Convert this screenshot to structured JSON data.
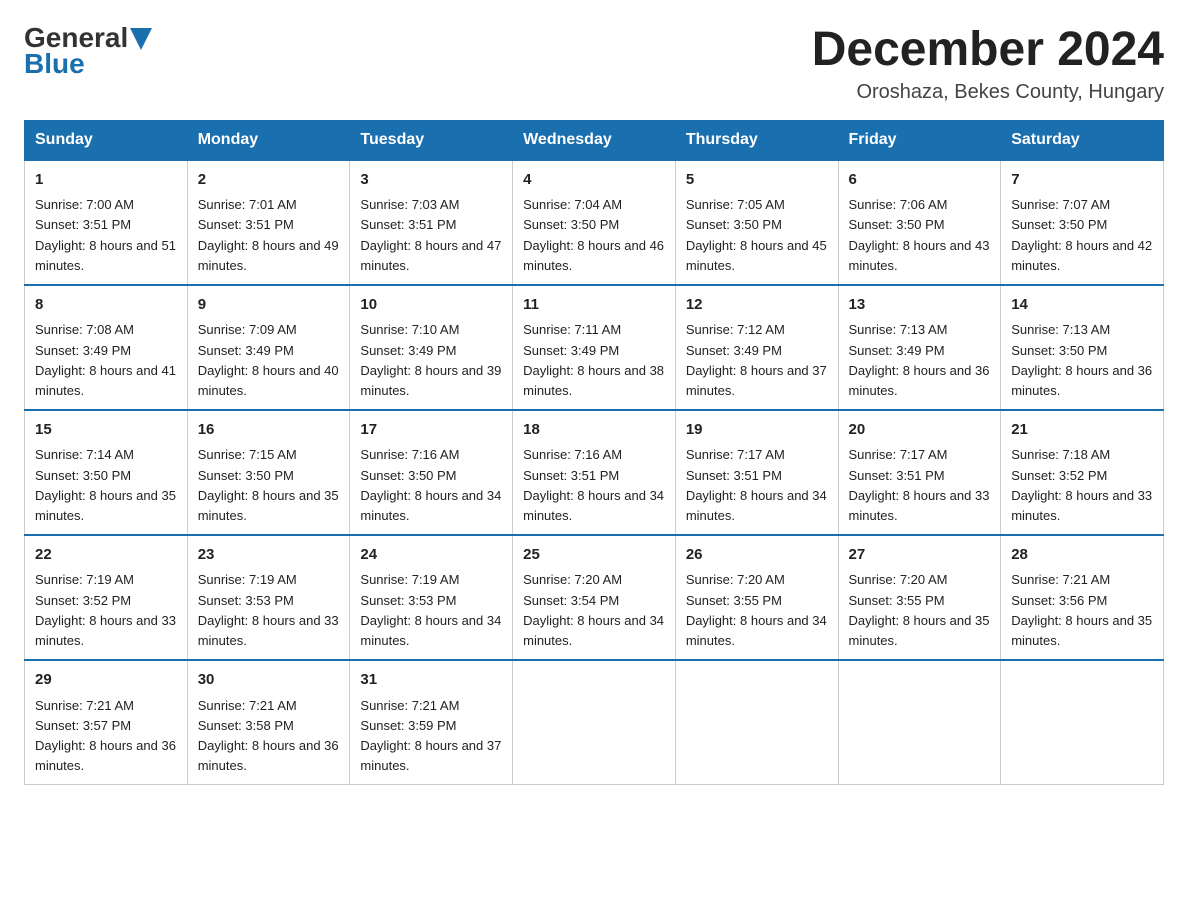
{
  "logo": {
    "general": "General",
    "blue": "Blue"
  },
  "title": "December 2024",
  "subtitle": "Oroshaza, Bekes County, Hungary",
  "days_of_week": [
    "Sunday",
    "Monday",
    "Tuesday",
    "Wednesday",
    "Thursday",
    "Friday",
    "Saturday"
  ],
  "weeks": [
    [
      {
        "day": "1",
        "sunrise": "Sunrise: 7:00 AM",
        "sunset": "Sunset: 3:51 PM",
        "daylight": "Daylight: 8 hours and 51 minutes."
      },
      {
        "day": "2",
        "sunrise": "Sunrise: 7:01 AM",
        "sunset": "Sunset: 3:51 PM",
        "daylight": "Daylight: 8 hours and 49 minutes."
      },
      {
        "day": "3",
        "sunrise": "Sunrise: 7:03 AM",
        "sunset": "Sunset: 3:51 PM",
        "daylight": "Daylight: 8 hours and 47 minutes."
      },
      {
        "day": "4",
        "sunrise": "Sunrise: 7:04 AM",
        "sunset": "Sunset: 3:50 PM",
        "daylight": "Daylight: 8 hours and 46 minutes."
      },
      {
        "day": "5",
        "sunrise": "Sunrise: 7:05 AM",
        "sunset": "Sunset: 3:50 PM",
        "daylight": "Daylight: 8 hours and 45 minutes."
      },
      {
        "day": "6",
        "sunrise": "Sunrise: 7:06 AM",
        "sunset": "Sunset: 3:50 PM",
        "daylight": "Daylight: 8 hours and 43 minutes."
      },
      {
        "day": "7",
        "sunrise": "Sunrise: 7:07 AM",
        "sunset": "Sunset: 3:50 PM",
        "daylight": "Daylight: 8 hours and 42 minutes."
      }
    ],
    [
      {
        "day": "8",
        "sunrise": "Sunrise: 7:08 AM",
        "sunset": "Sunset: 3:49 PM",
        "daylight": "Daylight: 8 hours and 41 minutes."
      },
      {
        "day": "9",
        "sunrise": "Sunrise: 7:09 AM",
        "sunset": "Sunset: 3:49 PM",
        "daylight": "Daylight: 8 hours and 40 minutes."
      },
      {
        "day": "10",
        "sunrise": "Sunrise: 7:10 AM",
        "sunset": "Sunset: 3:49 PM",
        "daylight": "Daylight: 8 hours and 39 minutes."
      },
      {
        "day": "11",
        "sunrise": "Sunrise: 7:11 AM",
        "sunset": "Sunset: 3:49 PM",
        "daylight": "Daylight: 8 hours and 38 minutes."
      },
      {
        "day": "12",
        "sunrise": "Sunrise: 7:12 AM",
        "sunset": "Sunset: 3:49 PM",
        "daylight": "Daylight: 8 hours and 37 minutes."
      },
      {
        "day": "13",
        "sunrise": "Sunrise: 7:13 AM",
        "sunset": "Sunset: 3:49 PM",
        "daylight": "Daylight: 8 hours and 36 minutes."
      },
      {
        "day": "14",
        "sunrise": "Sunrise: 7:13 AM",
        "sunset": "Sunset: 3:50 PM",
        "daylight": "Daylight: 8 hours and 36 minutes."
      }
    ],
    [
      {
        "day": "15",
        "sunrise": "Sunrise: 7:14 AM",
        "sunset": "Sunset: 3:50 PM",
        "daylight": "Daylight: 8 hours and 35 minutes."
      },
      {
        "day": "16",
        "sunrise": "Sunrise: 7:15 AM",
        "sunset": "Sunset: 3:50 PM",
        "daylight": "Daylight: 8 hours and 35 minutes."
      },
      {
        "day": "17",
        "sunrise": "Sunrise: 7:16 AM",
        "sunset": "Sunset: 3:50 PM",
        "daylight": "Daylight: 8 hours and 34 minutes."
      },
      {
        "day": "18",
        "sunrise": "Sunrise: 7:16 AM",
        "sunset": "Sunset: 3:51 PM",
        "daylight": "Daylight: 8 hours and 34 minutes."
      },
      {
        "day": "19",
        "sunrise": "Sunrise: 7:17 AM",
        "sunset": "Sunset: 3:51 PM",
        "daylight": "Daylight: 8 hours and 34 minutes."
      },
      {
        "day": "20",
        "sunrise": "Sunrise: 7:17 AM",
        "sunset": "Sunset: 3:51 PM",
        "daylight": "Daylight: 8 hours and 33 minutes."
      },
      {
        "day": "21",
        "sunrise": "Sunrise: 7:18 AM",
        "sunset": "Sunset: 3:52 PM",
        "daylight": "Daylight: 8 hours and 33 minutes."
      }
    ],
    [
      {
        "day": "22",
        "sunrise": "Sunrise: 7:19 AM",
        "sunset": "Sunset: 3:52 PM",
        "daylight": "Daylight: 8 hours and 33 minutes."
      },
      {
        "day": "23",
        "sunrise": "Sunrise: 7:19 AM",
        "sunset": "Sunset: 3:53 PM",
        "daylight": "Daylight: 8 hours and 33 minutes."
      },
      {
        "day": "24",
        "sunrise": "Sunrise: 7:19 AM",
        "sunset": "Sunset: 3:53 PM",
        "daylight": "Daylight: 8 hours and 34 minutes."
      },
      {
        "day": "25",
        "sunrise": "Sunrise: 7:20 AM",
        "sunset": "Sunset: 3:54 PM",
        "daylight": "Daylight: 8 hours and 34 minutes."
      },
      {
        "day": "26",
        "sunrise": "Sunrise: 7:20 AM",
        "sunset": "Sunset: 3:55 PM",
        "daylight": "Daylight: 8 hours and 34 minutes."
      },
      {
        "day": "27",
        "sunrise": "Sunrise: 7:20 AM",
        "sunset": "Sunset: 3:55 PM",
        "daylight": "Daylight: 8 hours and 35 minutes."
      },
      {
        "day": "28",
        "sunrise": "Sunrise: 7:21 AM",
        "sunset": "Sunset: 3:56 PM",
        "daylight": "Daylight: 8 hours and 35 minutes."
      }
    ],
    [
      {
        "day": "29",
        "sunrise": "Sunrise: 7:21 AM",
        "sunset": "Sunset: 3:57 PM",
        "daylight": "Daylight: 8 hours and 36 minutes."
      },
      {
        "day": "30",
        "sunrise": "Sunrise: 7:21 AM",
        "sunset": "Sunset: 3:58 PM",
        "daylight": "Daylight: 8 hours and 36 minutes."
      },
      {
        "day": "31",
        "sunrise": "Sunrise: 7:21 AM",
        "sunset": "Sunset: 3:59 PM",
        "daylight": "Daylight: 8 hours and 37 minutes."
      },
      null,
      null,
      null,
      null
    ]
  ]
}
